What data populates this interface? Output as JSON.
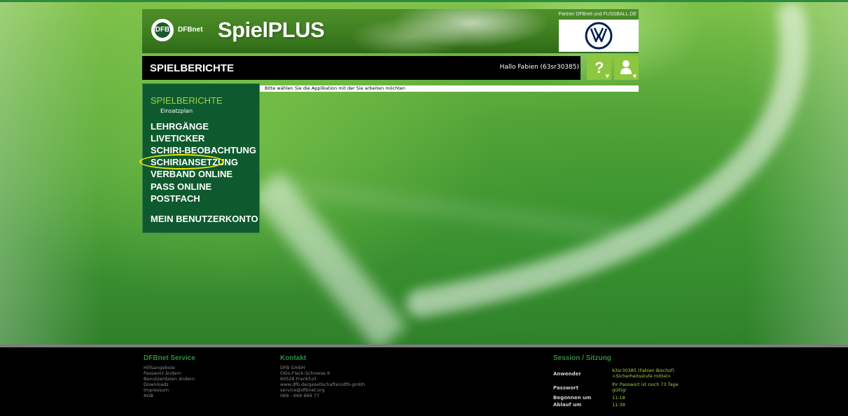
{
  "header": {
    "brand_small": "DFBnet",
    "product": "SpielPLUS",
    "partner": "Partner DFBnet und FUSSBALL.DE",
    "dfb_logo_text": "DFB"
  },
  "titlebar": {
    "title": "SPIELBERICHTE",
    "greeting": "Hallo Fabien (63sr30385)",
    "help_symbol": "?"
  },
  "message": "Bitte wählen Sie die Applikation mit der Sie arbeiten möchten",
  "sidebar": {
    "items": [
      {
        "label": "SPIELBERICHTE",
        "active": true
      },
      {
        "label": "Einsatzplan",
        "sub": true
      },
      {
        "label": "LEHRGÄNGE"
      },
      {
        "label": "LIVETICKER"
      },
      {
        "label": "SCHIRI-BEOBACHTUNG"
      },
      {
        "label": "SCHIRIANSETZUNG",
        "highlighted": true
      },
      {
        "label": "VERBAND ONLINE"
      },
      {
        "label": "PASS ONLINE"
      },
      {
        "label": "POSTFACH"
      },
      {
        "label": "MEIN BENUTZERKONTO"
      }
    ]
  },
  "footer": {
    "service": {
      "heading": "DFBnet Service",
      "links": [
        "Hilfsangebote",
        "Passwort ändern",
        "Benutzerdaten ändern",
        "Downloads",
        "Impressum",
        "AGB"
      ]
    },
    "contact": {
      "heading": "Kontakt",
      "lines": [
        "DFB GmbH",
        "Otto-Fleck-Schneise 6",
        "60528 Frankfurt",
        "www.dfb.de/gesellschaften/dfb-gmbh",
        "service@dfbnet.org",
        "069 - 669 669 77"
      ]
    },
    "session": {
      "heading": "Session / Sitzung",
      "user_label": "Anwender",
      "user_value": "63sr30385 (Fabien Bischof)",
      "user_security": "<Sicherheitsstufe mittel>",
      "password_label": "Passwort",
      "password_value_1": "Ihr Passwort ist noch 73 Tage",
      "password_value_2": "gültig!",
      "started_label": "Begonnen um",
      "started_value": "11:18",
      "expires_label": "Ablauf um",
      "expires_value": "11:39"
    }
  },
  "colors": {
    "accent_green": "#8dc63f",
    "sidebar_bg": "#0e5a2e",
    "highlight": "#f5e600",
    "footer_heading": "#2e8b3e"
  }
}
